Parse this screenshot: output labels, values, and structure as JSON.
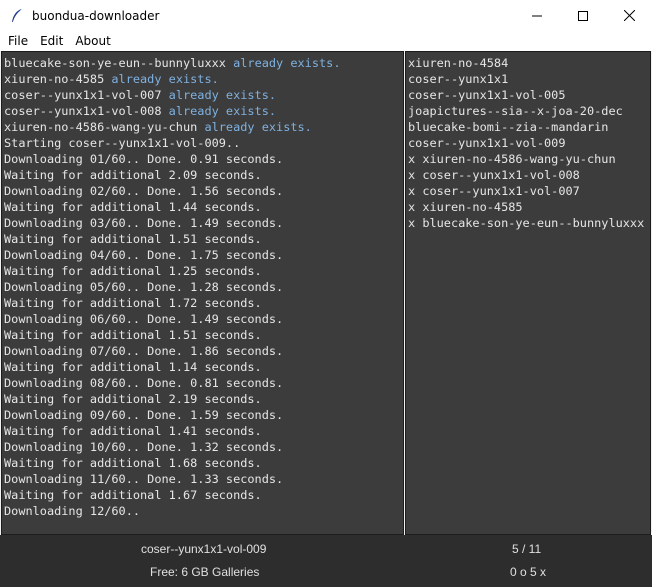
{
  "window": {
    "title": "buondua-downloader"
  },
  "menu": {
    "file": "File",
    "edit": "Edit",
    "about": "About"
  },
  "log": [
    {
      "text": "bluecake-son-ye-eun--bunnyluxxx ",
      "suffix": "already exists."
    },
    {
      "text": "xiuren-no-4585 ",
      "suffix": "already exists."
    },
    {
      "text": "coser--yunx1x1-vol-007 ",
      "suffix": "already exists."
    },
    {
      "text": "coser--yunx1x1-vol-008 ",
      "suffix": "already exists."
    },
    {
      "text": "xiuren-no-4586-wang-yu-chun ",
      "suffix": "already exists."
    },
    {
      "text": "Starting coser--yunx1x1-vol-009..",
      "suffix": ""
    },
    {
      "text": "Downloading 01/60.. Done. 0.91 seconds.",
      "suffix": ""
    },
    {
      "text": "Waiting for additional 2.09 seconds.",
      "suffix": ""
    },
    {
      "text": "Downloading 02/60.. Done. 1.56 seconds.",
      "suffix": ""
    },
    {
      "text": "Waiting for additional 1.44 seconds.",
      "suffix": ""
    },
    {
      "text": "Downloading 03/60.. Done. 1.49 seconds.",
      "suffix": ""
    },
    {
      "text": "Waiting for additional 1.51 seconds.",
      "suffix": ""
    },
    {
      "text": "Downloading 04/60.. Done. 1.75 seconds.",
      "suffix": ""
    },
    {
      "text": "Waiting for additional 1.25 seconds.",
      "suffix": ""
    },
    {
      "text": "Downloading 05/60.. Done. 1.28 seconds.",
      "suffix": ""
    },
    {
      "text": "Waiting for additional 1.72 seconds.",
      "suffix": ""
    },
    {
      "text": "Downloading 06/60.. Done. 1.49 seconds.",
      "suffix": ""
    },
    {
      "text": "Waiting for additional 1.51 seconds.",
      "suffix": ""
    },
    {
      "text": "Downloading 07/60.. Done. 1.86 seconds.",
      "suffix": ""
    },
    {
      "text": "Waiting for additional 1.14 seconds.",
      "suffix": ""
    },
    {
      "text": "Downloading 08/60.. Done. 0.81 seconds.",
      "suffix": ""
    },
    {
      "text": "Waiting for additional 2.19 seconds.",
      "suffix": ""
    },
    {
      "text": "Downloading 09/60.. Done. 1.59 seconds.",
      "suffix": ""
    },
    {
      "text": "Waiting for additional 1.41 seconds.",
      "suffix": ""
    },
    {
      "text": "Downloading 10/60.. Done. 1.32 seconds.",
      "suffix": ""
    },
    {
      "text": "Waiting for additional 1.68 seconds.",
      "suffix": ""
    },
    {
      "text": "Downloading 11/60.. Done. 1.33 seconds.",
      "suffix": ""
    },
    {
      "text": "Waiting for additional 1.67 seconds.",
      "suffix": ""
    },
    {
      "text": "Downloading 12/60..",
      "suffix": ""
    }
  ],
  "queue": [
    "xiuren-no-4584",
    "coser--yunx1x1",
    "coser--yunx1x1-vol-005",
    "joapictures--sia--x-joa-20-dec",
    "bluecake-bomi--zia--mandarin",
    "coser--yunx1x1-vol-009",
    "x xiuren-no-4586-wang-yu-chun",
    "x coser--yunx1x1-vol-008",
    "x coser--yunx1x1-vol-007",
    "x xiuren-no-4585",
    "x bluecake-son-ye-eun--bunnyluxxx"
  ],
  "status": {
    "current_gallery": "coser--yunx1x1-vol-009",
    "gallery_count": "5 / 11",
    "free_space": "Free: 6 GB  Galleries",
    "progress": "0 o 5 x"
  },
  "colors": {
    "log_background": "#3c3c3c",
    "log_text": "#e6e6e6",
    "highlight_text": "#7fb1e0",
    "status_background": "#2d2d2d"
  },
  "icons": {
    "app": "feather-icon",
    "minimize": "minimize-icon",
    "maximize": "maximize-icon",
    "close": "close-icon"
  }
}
